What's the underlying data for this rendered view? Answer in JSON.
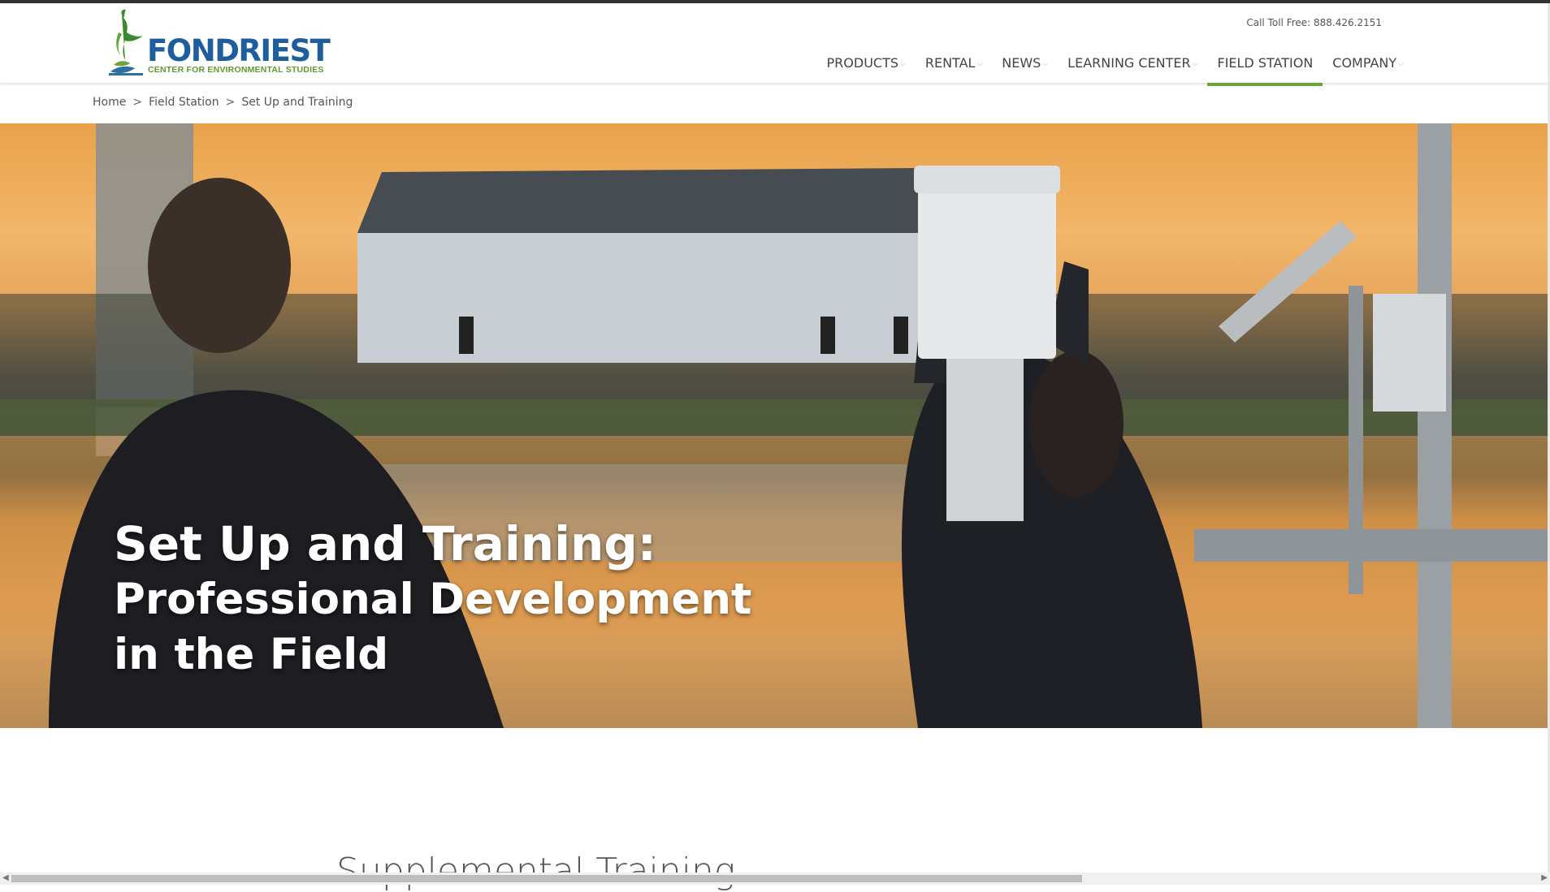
{
  "header": {
    "logo": {
      "name": "FONDRIEST",
      "tagline": "CENTER FOR ENVIRONMENTAL STUDIES",
      "icon": "heron-logo-icon"
    },
    "toll_free": "Call Toll Free: 888.426.2151",
    "nav": [
      {
        "label": "PRODUCTS",
        "dropdown": true,
        "active": false
      },
      {
        "label": "RENTAL",
        "dropdown": true,
        "active": false
      },
      {
        "label": "NEWS",
        "dropdown": true,
        "active": false
      },
      {
        "label": "LEARNING CENTER",
        "dropdown": true,
        "active": false
      },
      {
        "label": "FIELD STATION",
        "dropdown": false,
        "active": true
      },
      {
        "label": "COMPANY",
        "dropdown": true,
        "active": false
      }
    ],
    "colors": {
      "brand_blue": "#1e5e9e",
      "brand_green": "#6aa33a"
    }
  },
  "breadcrumb": {
    "items": [
      "Home",
      "Field Station",
      "Set Up and Training"
    ],
    "separator": ">"
  },
  "hero": {
    "title_line1": "Set Up and Training:",
    "title_line2": "Professional Development",
    "title_line3": "in the Field",
    "image": "field-station-sunset-photo"
  },
  "main": {
    "section_title": "Supplemental Training"
  }
}
